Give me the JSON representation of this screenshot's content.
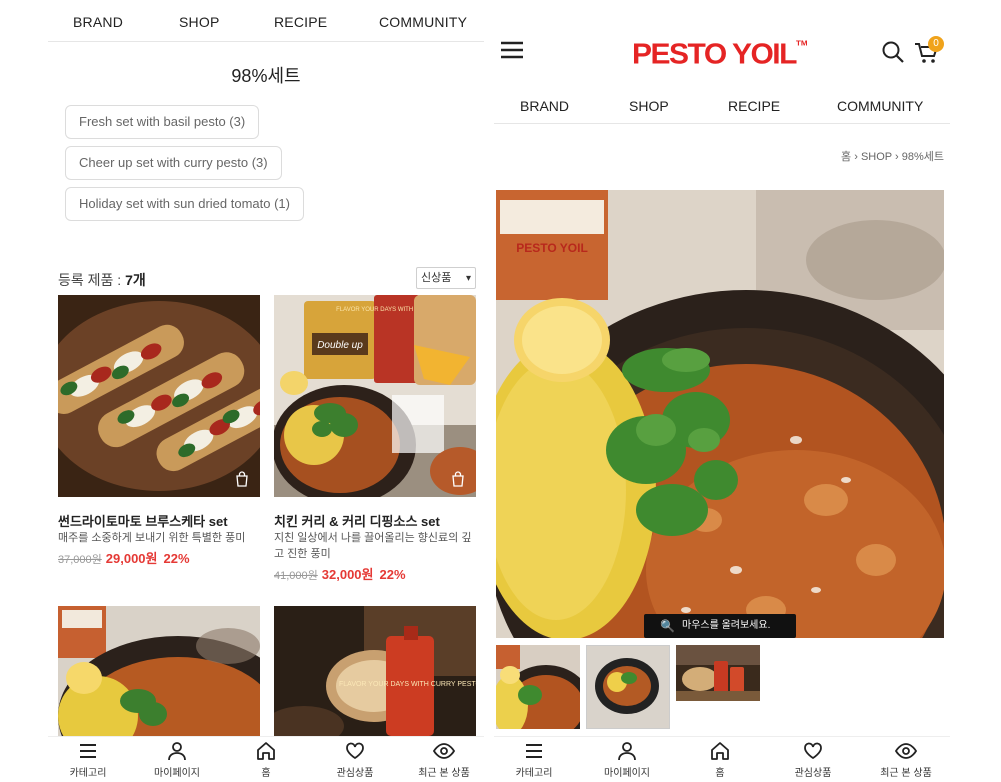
{
  "nav": {
    "brand": "BRAND",
    "shop": "SHOP",
    "recipe": "RECIPE",
    "community": "COMMUNITY"
  },
  "category": {
    "title": "98%세트",
    "subcategories": [
      "Fresh set with basil pesto (3)",
      "Cheer up set with curry pesto (3)",
      "Holiday set with sun dried tomato (1)"
    ]
  },
  "listing": {
    "count_prefix": "등록 제품 : ",
    "count_value": "7개",
    "sort_value": "신상품"
  },
  "products": [
    {
      "name": "썬드라이토마토 브루스케타 set",
      "desc": "매주를 소중하게 보내기 위한 특별한 풍미",
      "orig_price": "37,000원",
      "sale_price": "29,000원",
      "discount": "22%"
    },
    {
      "name": "치킨 커리 & 커리 디핑소스 set",
      "desc": "지친 일상에서 나를 끌어올리는 향신료의 깊고 진한 풍미",
      "orig_price": "41,000원",
      "sale_price": "32,000원",
      "discount": "22%"
    }
  ],
  "product_image_text": {
    "bag1": "Double up",
    "pouch": "FLAVOR YOUR DAYS WITH CURRY PESTO",
    "jar": "PESTO YOIL"
  },
  "bottom_nav": [
    "카테고리",
    "마이페이지",
    "홈",
    "관심상품",
    "최근 본 상품"
  ],
  "right": {
    "logo": "PESTO YOIL",
    "logo_tm": "TM",
    "cart_count": "0",
    "breadcrumb": [
      "홈",
      "SHOP",
      "98%세트"
    ],
    "hover_hint": "마우스를 올려보세요."
  },
  "colors": {
    "brand_red": "#e52424",
    "sale_red": "#e53935",
    "badge": "#f0a31b"
  }
}
